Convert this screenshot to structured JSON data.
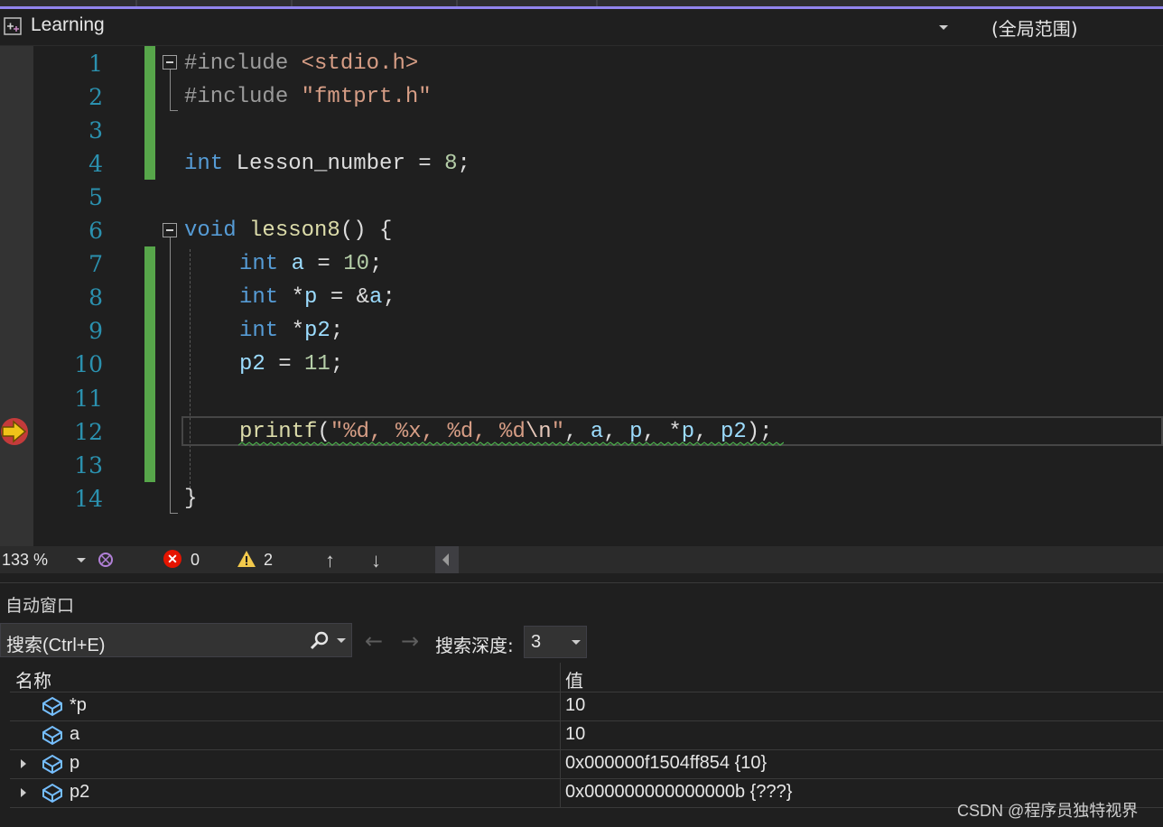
{
  "navbar": {
    "project": "Learning",
    "scope": "(全局范围)"
  },
  "editor": {
    "line_numbers": [
      "1",
      "2",
      "3",
      "4",
      "5",
      "6",
      "7",
      "8",
      "9",
      "10",
      "11",
      "12",
      "13",
      "14"
    ],
    "lines": {
      "l1_pp": "#include ",
      "l1_hdr": "<stdio.h>",
      "l2_pp": "#include ",
      "l2_hdr": "\"fmtprt.h\"",
      "l4_kw": "int",
      "l4_name": " Lesson_number = ",
      "l4_num": "8",
      "l4_end": ";",
      "l6_kw": "void",
      "l6_fn": "lesson8",
      "l6_rest": "() {",
      "l7_kw": "int",
      "l7_var": "a",
      "l7_op": " = ",
      "l7_num": "10",
      "l7_end": ";",
      "l8_kw": "int",
      "l8_op1": " *",
      "l8_var": "p",
      "l8_op2": " = &",
      "l8_var2": "a",
      "l8_end": ";",
      "l9_kw": "int",
      "l9_op": " *",
      "l9_var": "p2",
      "l9_end": ";",
      "l10_var": "p2",
      "l10_op": " = ",
      "l10_num": "11",
      "l10_end": ";",
      "l12_fn": "printf",
      "l12_open": "(",
      "l12_str1": "\"%d, %x, %d, %d",
      "l12_esc": "\\n",
      "l12_str2": "\"",
      "l12_sep1": ", ",
      "l12_a": "a",
      "l12_sep2": ", ",
      "l12_p": "p",
      "l12_sep3": ", *",
      "l12_p3": "p",
      "l12_sep4": ", ",
      "l12_p2": "p2",
      "l12_close": ");",
      "l14_close": "}"
    }
  },
  "status": {
    "zoom": "133 %",
    "errors": "0",
    "warnings": "2",
    "up": "↑",
    "down": "↓"
  },
  "autos": {
    "title": "自动窗口",
    "search_placeholder": "搜索(Ctrl+E)",
    "depth_label": "搜索深度:",
    "depth_value": "3",
    "col_name": "名称",
    "col_value": "值",
    "rows": [
      {
        "name": "*p",
        "value": "10",
        "expandable": false
      },
      {
        "name": "a",
        "value": "10",
        "expandable": false
      },
      {
        "name": "p",
        "value": "0x000000f1504ff854 {10}",
        "expandable": true
      },
      {
        "name": "p2",
        "value": "0x000000000000000b {???}",
        "expandable": true
      }
    ]
  },
  "watermark": "CSDN @程序员独特视界",
  "colors": {
    "background": "#1f1f1f",
    "keyword": "#569cd6",
    "string": "#d69d85",
    "number": "#b5cea8",
    "variable": "#9cdcfe",
    "function": "#dcdcaa",
    "line_number": "#2b91af",
    "change_bar": "#57a64a",
    "accent": "#9184ee"
  }
}
